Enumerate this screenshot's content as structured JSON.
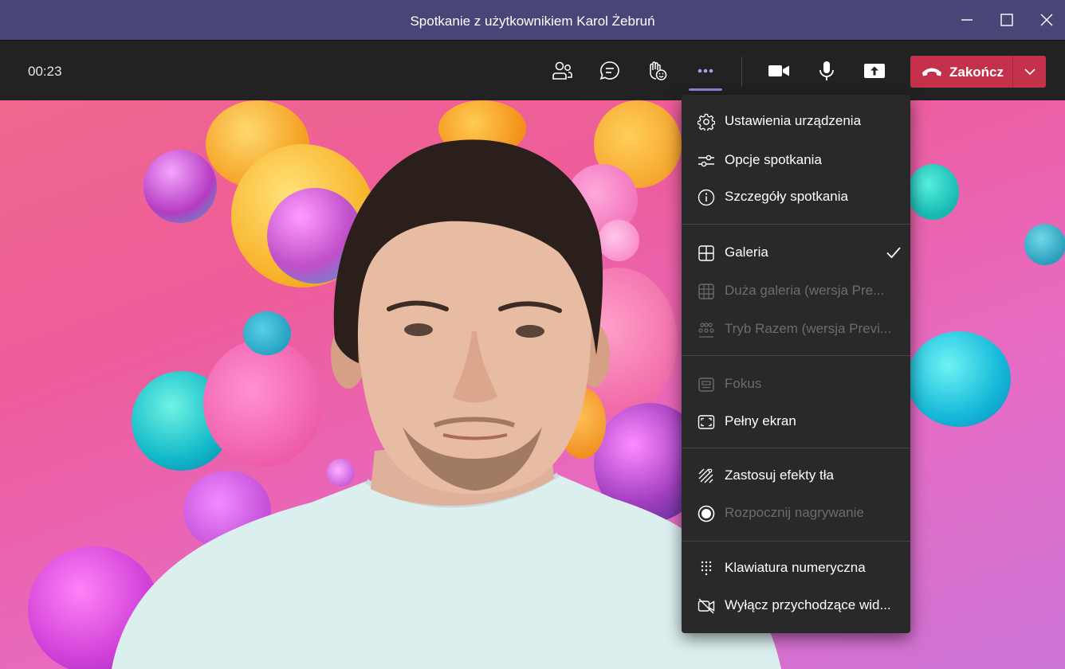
{
  "window": {
    "title": "Spotkanie z użytkownikiem Karol Żebruń"
  },
  "toolbar": {
    "timer": "00:23",
    "buttons": [
      {
        "icon": "people-icon"
      },
      {
        "icon": "chat-icon"
      },
      {
        "icon": "raise-hand-icon"
      },
      {
        "icon": "more-options-icon",
        "active": true
      },
      {
        "icon": "camera-icon"
      },
      {
        "icon": "microphone-icon"
      },
      {
        "icon": "share-screen-icon"
      }
    ],
    "end_call_label": "Zakończ"
  },
  "menu": {
    "items": [
      {
        "label": "Ustawienia urządzenia",
        "icon": "gear-icon",
        "enabled": true
      },
      {
        "label": "Opcje spotkania",
        "icon": "sliders-icon",
        "enabled": true
      },
      {
        "label": "Szczegóły spotkania",
        "icon": "info-icon",
        "enabled": true
      },
      {
        "label": "Galeria",
        "icon": "gallery-grid-icon",
        "enabled": true,
        "checked": true
      },
      {
        "label": "Duża galeria (wersja Pre...",
        "icon": "large-gallery-icon",
        "enabled": false
      },
      {
        "label": "Tryb Razem (wersja Previ...",
        "icon": "together-mode-icon",
        "enabled": false
      },
      {
        "label": "Fokus",
        "icon": "focus-icon",
        "enabled": false
      },
      {
        "label": "Pełny ekran",
        "icon": "fullscreen-icon",
        "enabled": true
      },
      {
        "label": "Zastosuj efekty tła",
        "icon": "background-effects-icon",
        "enabled": true
      },
      {
        "label": "Rozpocznij nagrywanie",
        "icon": "record-icon",
        "enabled": false
      },
      {
        "label": "Klawiatura numeryczna",
        "icon": "dialpad-icon",
        "enabled": true
      },
      {
        "label": "Wyłącz przychodzące wid...",
        "icon": "video-off-icon",
        "enabled": true
      }
    ]
  },
  "colors": {
    "titlebar": "#494677",
    "toolbar": "#222222",
    "accent": "#8c86d9",
    "end_call": "#c4314b",
    "menu_bg": "#292929"
  }
}
